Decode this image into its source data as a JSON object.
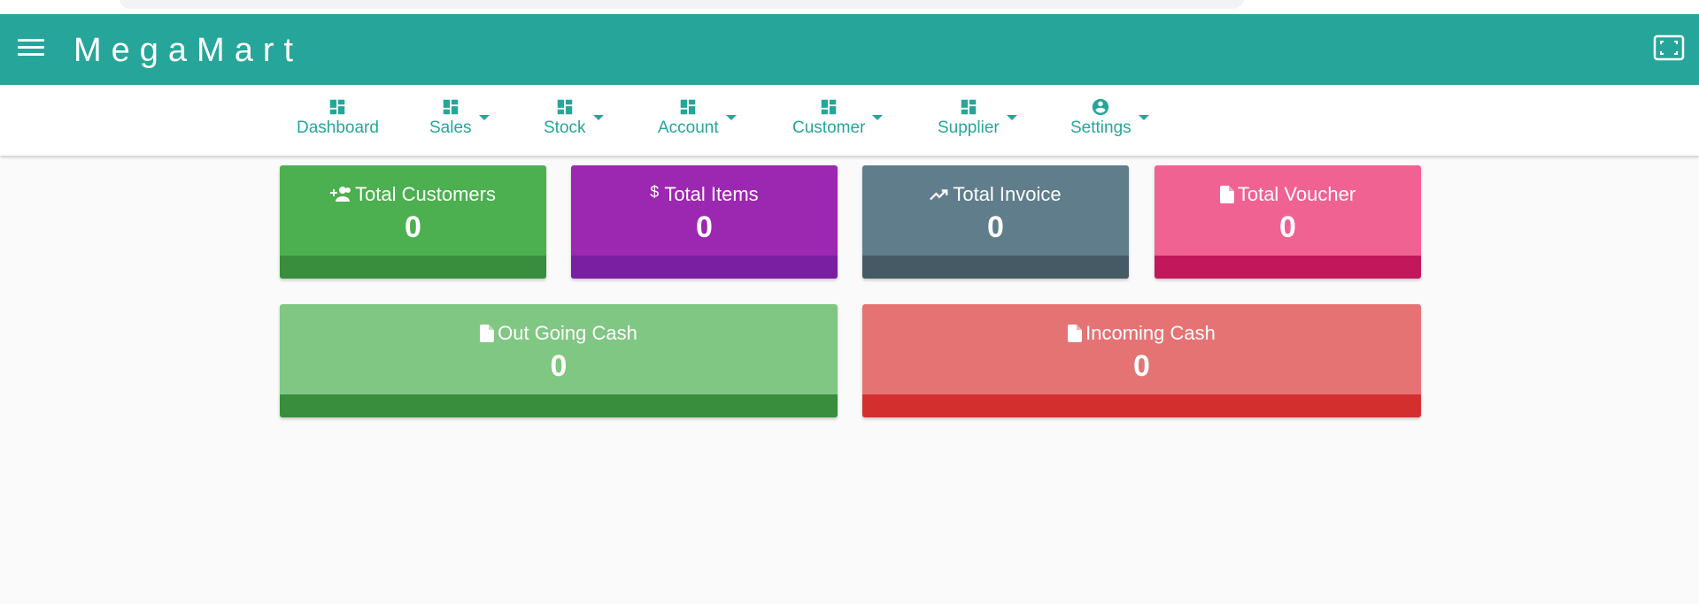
{
  "app": {
    "title": "MegaMart"
  },
  "header": {
    "menu_icon": "menu-icon",
    "fullscreen_icon": "fullscreen-icon",
    "color": "#26a69a"
  },
  "nav": {
    "items": [
      {
        "label": "Dashboard",
        "icon": "dashboard-icon",
        "has_dropdown": false
      },
      {
        "label": "Sales",
        "icon": "dashboard-icon",
        "has_dropdown": true
      },
      {
        "label": "Stock",
        "icon": "dashboard-icon",
        "has_dropdown": true
      },
      {
        "label": "Account",
        "icon": "dashboard-icon",
        "has_dropdown": true
      },
      {
        "label": "Customer",
        "icon": "dashboard-icon",
        "has_dropdown": true
      },
      {
        "label": "Supplier",
        "icon": "dashboard-icon",
        "has_dropdown": true
      },
      {
        "label": "Settings",
        "icon": "account-circle-icon",
        "has_dropdown": true
      }
    ]
  },
  "cards": [
    {
      "title": "Total Customers",
      "value": "0",
      "icon": "group-add-icon",
      "color": "#4caf50",
      "footer_color": "#388e3c"
    },
    {
      "title": "Total Items",
      "value": "0",
      "icon": "dollar-icon",
      "color": "#9c27b0",
      "footer_color": "#7b1fa2"
    },
    {
      "title": "Total Invoice",
      "value": "0",
      "icon": "trending-up-icon",
      "color": "#607d8b",
      "footer_color": "#455a64"
    },
    {
      "title": "Total Voucher",
      "value": "0",
      "icon": "document-icon",
      "color": "#f06292",
      "footer_color": "#c2185b"
    },
    {
      "title": "Out Going Cash",
      "value": "0",
      "icon": "document-icon",
      "color": "#81c784",
      "footer_color": "#388e3c"
    },
    {
      "title": "Incoming Cash",
      "value": "0",
      "icon": "document-icon",
      "color": "#e57373",
      "footer_color": "#d32f2f"
    }
  ]
}
